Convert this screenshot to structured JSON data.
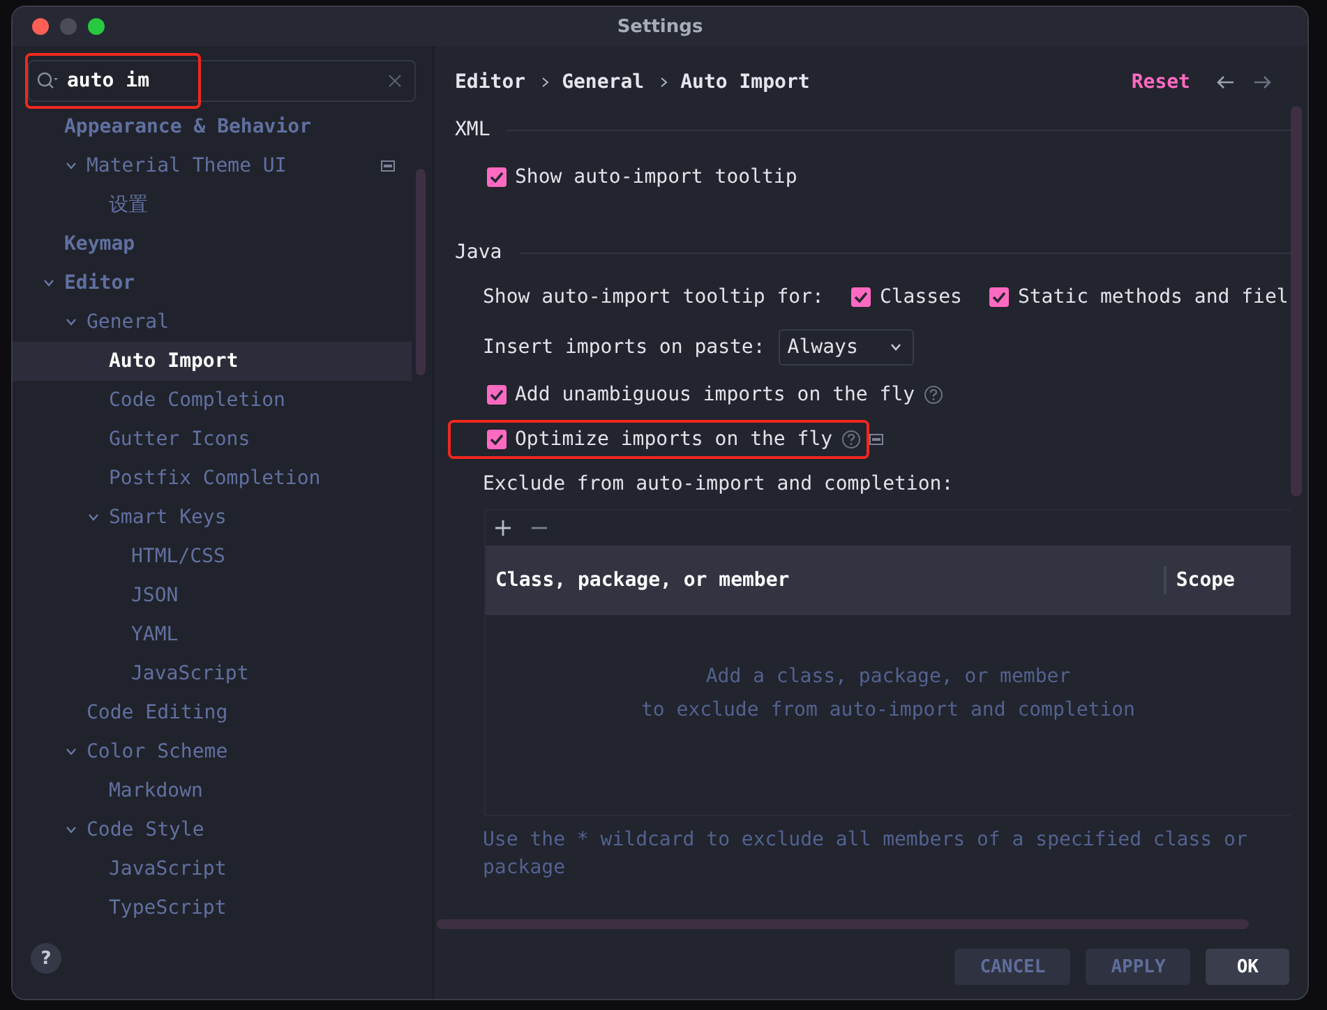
{
  "window": {
    "title": "Settings"
  },
  "search": {
    "value": "auto im",
    "highlighted": true
  },
  "tree": [
    {
      "label": "Appearance & Behavior",
      "expanded": false,
      "selected": false,
      "children": [
        {
          "label": "Material Theme UI",
          "expanded": true,
          "selected": false,
          "marker": true,
          "children": [
            {
              "label": "设置",
              "expanded": false,
              "selected": false
            }
          ]
        }
      ]
    },
    {
      "label": "Keymap",
      "expanded": false,
      "selected": false
    },
    {
      "label": "Editor",
      "expanded": true,
      "selected": false,
      "children": [
        {
          "label": "General",
          "expanded": true,
          "selected": false,
          "children": [
            {
              "label": "Auto Import",
              "expanded": false,
              "selected": true
            },
            {
              "label": "Code Completion",
              "expanded": false,
              "selected": false
            },
            {
              "label": "Gutter Icons",
              "expanded": false,
              "selected": false
            },
            {
              "label": "Postfix Completion",
              "expanded": false,
              "selected": false
            },
            {
              "label": "Smart Keys",
              "expanded": true,
              "selected": false,
              "children": [
                {
                  "label": "HTML/CSS",
                  "expanded": false,
                  "selected": false
                },
                {
                  "label": "JSON",
                  "expanded": false,
                  "selected": false
                },
                {
                  "label": "YAML",
                  "expanded": false,
                  "selected": false
                },
                {
                  "label": "JavaScript",
                  "expanded": false,
                  "selected": false
                }
              ]
            }
          ]
        },
        {
          "label": "Code Editing",
          "expanded": false,
          "selected": false
        },
        {
          "label": "Color Scheme",
          "expanded": true,
          "selected": false,
          "children": [
            {
              "label": "Markdown",
              "expanded": false,
              "selected": false
            }
          ]
        },
        {
          "label": "Code Style",
          "expanded": true,
          "selected": false,
          "children": [
            {
              "label": "JavaScript",
              "expanded": false,
              "selected": false
            },
            {
              "label": "TypeScript",
              "expanded": false,
              "selected": false
            }
          ]
        }
      ]
    }
  ],
  "breadcrumb": [
    "Editor",
    "General",
    "Auto Import"
  ],
  "reset": "Reset",
  "sections": [
    {
      "title": "XML",
      "rows": [
        {
          "kind": "checkbox",
          "label": "Show auto-import tooltip",
          "checked": true
        }
      ]
    },
    {
      "title": "Java",
      "rows": [
        {
          "kind": "multi",
          "label": "Show auto-import tooltip for:",
          "options": [
            {
              "label": "Classes",
              "checked": true
            },
            {
              "label": "Static methods and fiel",
              "checked": true
            }
          ]
        },
        {
          "kind": "select",
          "label": "Insert imports on paste:",
          "value": "Always"
        },
        {
          "kind": "checkbox",
          "label": "Add unambiguous imports on the fly",
          "checked": true,
          "help": true
        },
        {
          "kind": "checkbox",
          "label": "Optimize imports on the fly",
          "checked": true,
          "help": true,
          "marker": true,
          "highlighted": true
        },
        {
          "kind": "label",
          "label": "Exclude from auto-import and completion:"
        }
      ]
    }
  ],
  "exclude_table": {
    "columns": [
      "Class, package, or member",
      "Scope"
    ],
    "empty_text": [
      "Add a class, package, or member",
      "to exclude from auto-import and completion"
    ]
  },
  "hint": "Use the * wildcard to exclude all members of a specified class or package",
  "help_button": "?",
  "buttons": [
    {
      "label": "CANCEL",
      "kind": "secondary"
    },
    {
      "label": "APPLY",
      "kind": "secondary"
    },
    {
      "label": "OK",
      "kind": "primary"
    }
  ]
}
